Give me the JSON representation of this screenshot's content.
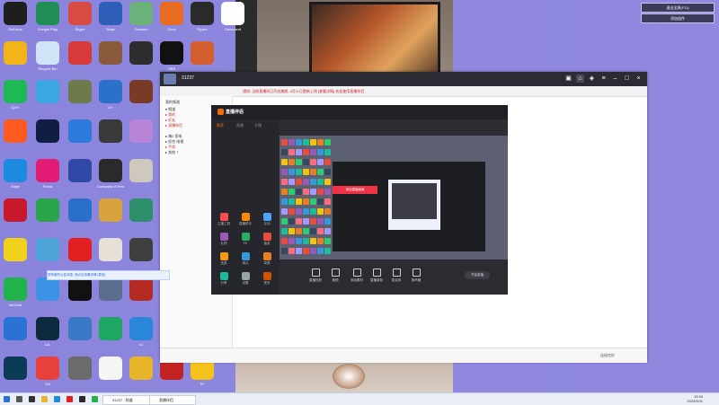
{
  "desktop_icons": [
    {
      "label": "GeForce",
      "color": "#1e1e1e"
    },
    {
      "label": "Google Play",
      "color": "#1f8f55"
    },
    {
      "label": "Skype",
      "color": "#d94a43"
    },
    {
      "label": "Snap",
      "color": "#2d5fb8"
    },
    {
      "label": "Genshin",
      "color": "#6ab27a"
    },
    {
      "label": "Ozon",
      "color": "#e86a23"
    },
    {
      "label": "Ryzen",
      "color": "#2a2a2a"
    },
    {
      "label": "Document",
      "color": "#ffffff"
    },
    {
      "label": "",
      "color": "#f2b418"
    },
    {
      "label": "Recycle Bin",
      "color": "#cfe4f7"
    },
    {
      "label": "",
      "color": "#d83a3a"
    },
    {
      "label": "",
      "color": "#8b5a3c"
    },
    {
      "label": "",
      "color": "#2e2e2e"
    },
    {
      "label": "OBS",
      "color": "#111111"
    },
    {
      "label": "",
      "color": "#d35e2f"
    },
    {
      "label": "iQIYI",
      "color": "#1db954"
    },
    {
      "label": "",
      "color": "#3aa7e0"
    },
    {
      "label": "",
      "color": "#6d7a4a"
    },
    {
      "label": "G+",
      "color": "#2b70c9"
    },
    {
      "label": "",
      "color": "#7a3b26"
    },
    {
      "label": "",
      "color": "#ff5a1f"
    },
    {
      "label": "",
      "color": "#0f1e42"
    },
    {
      "label": "",
      "color": "#2c7ad9"
    },
    {
      "label": "",
      "color": "#3a3a3a"
    },
    {
      "label": "",
      "color": "#b784d8"
    },
    {
      "label": "Edge",
      "color": "#1c8ae0"
    },
    {
      "label": "Forza",
      "color": "#e21c74"
    },
    {
      "label": "",
      "color": "#3049a6"
    },
    {
      "label": "Company of Heroes 2",
      "color": "#2a2a2a"
    },
    {
      "label": "",
      "color": "#cfc8bd"
    },
    {
      "label": "",
      "color": "#c8182b"
    },
    {
      "label": "",
      "color": "#2aa44a"
    },
    {
      "label": "",
      "color": "#2a6fc9"
    },
    {
      "label": "",
      "color": "#d8a23c"
    },
    {
      "label": "",
      "color": "#2e8f6b"
    },
    {
      "label": "",
      "color": "#f1d11b"
    },
    {
      "label": "",
      "color": "#4ba3d8"
    },
    {
      "label": "",
      "color": "#e32021"
    },
    {
      "label": "",
      "color": "#e6e0d6"
    },
    {
      "label": "",
      "color": "#3f3f3f"
    },
    {
      "label": "WeChat",
      "color": "#21b24c"
    },
    {
      "label": "",
      "color": "#3c93e6"
    },
    {
      "label": "",
      "color": "#111111"
    },
    {
      "label": "",
      "color": "#5b6e8e"
    },
    {
      "label": "",
      "color": "#b32a22"
    },
    {
      "label": "",
      "color": "#2a73d4"
    },
    {
      "label": "LoL",
      "color": "#0c2a3d"
    },
    {
      "label": "",
      "color": "#3b78c5"
    },
    {
      "label": "",
      "color": "#1ea663"
    },
    {
      "label": "iU",
      "color": "#2a86d8"
    },
    {
      "label": "",
      "color": "#0b3b56"
    },
    {
      "label": "GG",
      "color": "#e8413c"
    },
    {
      "label": "",
      "color": "#6b6b6b"
    },
    {
      "label": "",
      "color": "#f5f5f5"
    },
    {
      "label": "",
      "color": "#e8b52a"
    },
    {
      "label": "",
      "color": "#c22222"
    },
    {
      "label": "R*",
      "color": "#f4c21a"
    }
  ],
  "corner_buttons": [
    "退出全屏(F11)",
    "添加组件"
  ],
  "main_window": {
    "title": "31237",
    "notice": "通知: 当前直播间已开启美颜, 5月11日更新上线 [查看详情] 欢迎使用直播伴侣",
    "tree": [
      "我的频道",
      "▾ 频道",
      "  ▸ 我的",
      "  ▸ 好友",
      "  ▸ 直播伴侣",
      "▸ 嗨2 家电",
      "▸ 综合 电视",
      "▸ 手机",
      "▸ 其他 7"
    ],
    "tip": "您有新的公告消息, 请点击查看详情 [更多]",
    "bottom_status": "连接良好"
  },
  "inner_app": {
    "name": "直播伴侣",
    "tabs": [
      "推荐",
      "直播",
      "开播"
    ],
    "tool_labels": [
      "主播工具",
      "直播助手",
      "互动",
      "礼物",
      "PK",
      "抽奖",
      "连麦",
      "观众",
      "录屏",
      "分享",
      "设置",
      "更多"
    ],
    "controls": [
      "直播回放",
      "美颜",
      "添加素材",
      "直播录制",
      "麦克风",
      "扬声器",
      "开始直播"
    ],
    "red_tab": "添加直播画面"
  },
  "taskbar": {
    "apps": [
      "31237 - 频道",
      "直播伴侣"
    ],
    "tray_time": "19:34",
    "tray_date": "2023/5/11"
  },
  "colors": {
    "accent": "#ff6a00",
    "danger": "#ee3344",
    "wallpaper": "#8e86de"
  }
}
